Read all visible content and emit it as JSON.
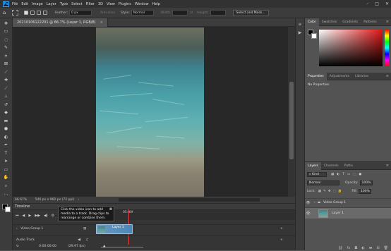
{
  "menubar": {
    "logo": "Ps",
    "items": [
      "File",
      "Edit",
      "Image",
      "Layer",
      "Type",
      "Select",
      "Filter",
      "3D",
      "View",
      "Plugins",
      "Window",
      "Help"
    ]
  },
  "options": {
    "feather_label": "Feather:",
    "feather_value": "0 px",
    "antialias_label": "Anti-alias",
    "style_label": "Style:",
    "style_value": "Normal",
    "width_label": "Width:",
    "height_label": "Height:",
    "select_mask_button": "Select and Mask..."
  },
  "document": {
    "tab_title": "20210106122201 @ 66.7% (Layer 1, RGB/8)",
    "zoom": "66.67%",
    "dimensions": "540 px x 960 px (72 ppi)"
  },
  "timeline": {
    "title": "Timeline",
    "time_marker": "05:00f",
    "video_group": "Video Group 1",
    "clip_label": "Layer 1",
    "audio_track": "Audio Track",
    "timecode": "0:00:00:00",
    "fps": "(29.97 fps)",
    "tooltip": "Click the video icon to add media to a track. Drag clips to rearrange or combine them."
  },
  "color_panel": {
    "tabs": [
      "Color",
      "Swatches",
      "Gradients",
      "Patterns"
    ],
    "active_tab": "Color",
    "hue_color": "#e11414"
  },
  "properties_panel": {
    "tabs": [
      "Properties",
      "Adjustments",
      "Libraries"
    ],
    "active_tab": "Properties",
    "body": "No Properties"
  },
  "layers_panel": {
    "tabs": [
      "Layers",
      "Channels",
      "Paths"
    ],
    "active_tab": "Layers",
    "filter_kind": "Kind",
    "blend_mode": "Normal",
    "opacity_label": "Opacity:",
    "opacity_value": "100%",
    "lock_label": "Lock:",
    "fill_label": "Fill:",
    "fill_value": "100%",
    "layers": [
      {
        "name": "Video Group 1",
        "type": "group"
      },
      {
        "name": "Layer 1",
        "type": "layer"
      }
    ]
  },
  "colors": {
    "accent": "#31a8ff",
    "panel_bg": "#535353",
    "dark_bg": "#323232"
  }
}
